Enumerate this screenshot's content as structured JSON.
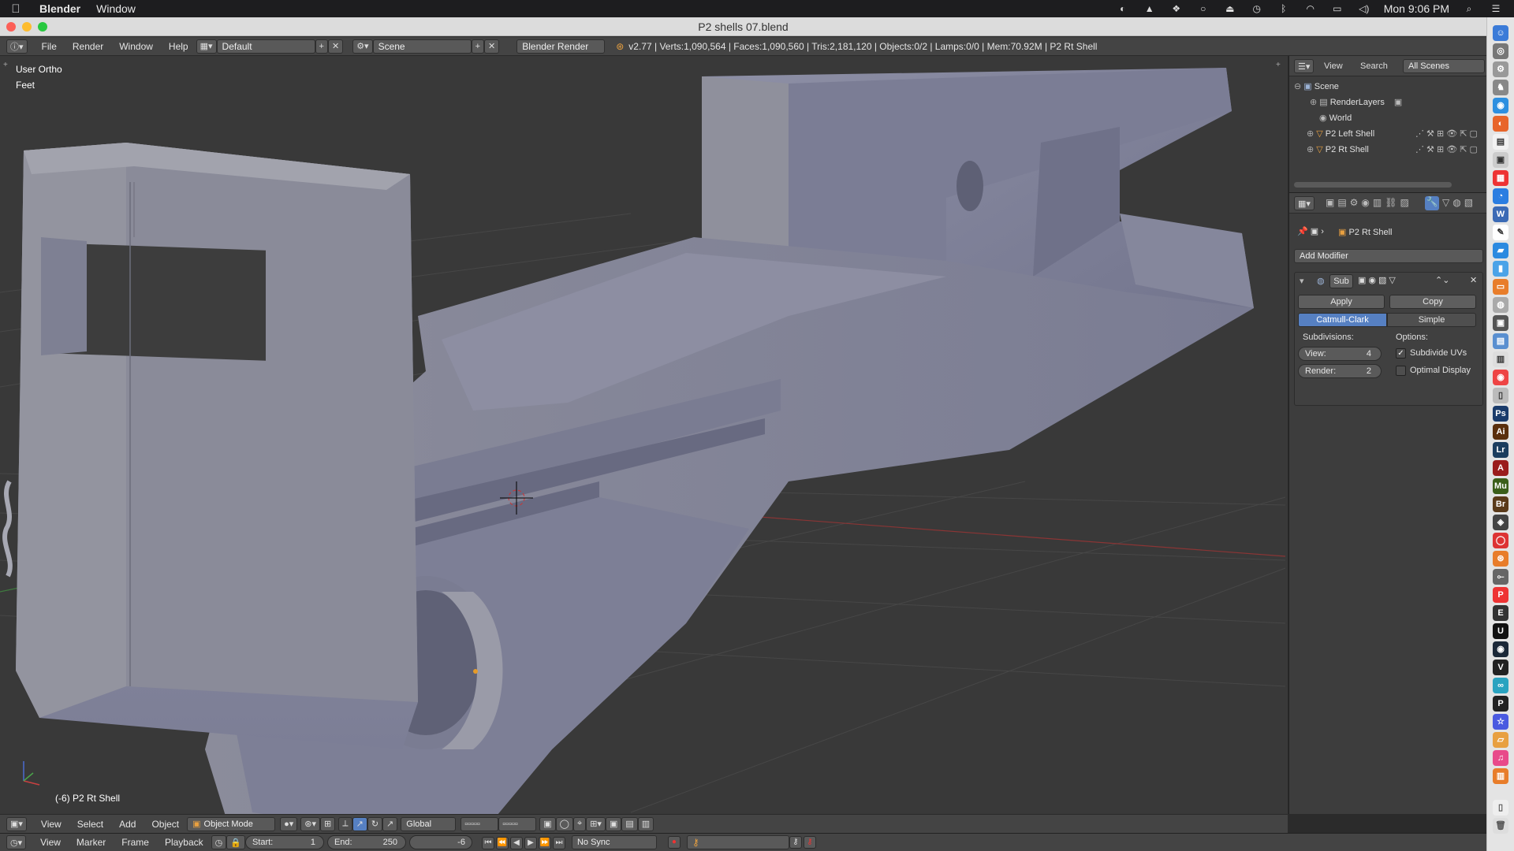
{
  "macos": {
    "app_name": "Blender",
    "menu_window": "Window",
    "clock": "Mon 9:06 PM"
  },
  "window": {
    "title": "P2 shells 07.blend"
  },
  "info_header": {
    "menus": [
      "File",
      "Render",
      "Window",
      "Help"
    ],
    "screen_layout": "Default",
    "scene": "Scene",
    "render_engine": "Blender Render",
    "stats": "v2.77 | Verts:1,090,564 | Faces:1,090,560 | Tris:2,181,120 | Objects:0/2 | Lamps:0/0 | Mem:70.92M | P2 Rt Shell"
  },
  "viewport": {
    "view_name": "User Ortho",
    "units": "Feet",
    "object_label": "(-6) P2 Rt Shell"
  },
  "outliner": {
    "menus": [
      "View",
      "Search"
    ],
    "filter": "All Scenes",
    "tree": [
      {
        "label": "Scene",
        "depth": 0
      },
      {
        "label": "RenderLayers",
        "depth": 1
      },
      {
        "label": "World",
        "depth": 1
      },
      {
        "label": "P2 Left Shell",
        "depth": 1
      },
      {
        "label": "P2 Rt Shell",
        "depth": 1
      }
    ]
  },
  "properties": {
    "context_object": "P2 Rt Shell",
    "add_modifier": "Add Modifier",
    "modifier_name": "Sub",
    "apply_label": "Apply",
    "copy_label": "Copy",
    "mode_catmull": "Catmull-Clark",
    "mode_simple": "Simple",
    "subdivisions_label": "Subdivisions:",
    "options_label": "Options:",
    "view_label": "View:",
    "view_value": "4",
    "render_label": "Render:",
    "render_value": "2",
    "subdivide_uvs": "Subdivide UVs",
    "subdivide_uvs_checked": true,
    "optimal_display": "Optimal Display",
    "optimal_display_checked": false
  },
  "viewport_header": {
    "menus": [
      "View",
      "Select",
      "Add",
      "Object"
    ],
    "mode": "Object Mode",
    "orientation": "Global"
  },
  "timeline": {
    "menus": [
      "View",
      "Marker",
      "Frame",
      "Playback"
    ],
    "start_label": "Start:",
    "start_value": "1",
    "end_label": "End:",
    "end_value": "250",
    "current_frame": "-6",
    "sync": "No Sync"
  },
  "colors": {
    "accent": "#5680c2",
    "model": "#7f8198",
    "viewport_bg": "#393939"
  }
}
